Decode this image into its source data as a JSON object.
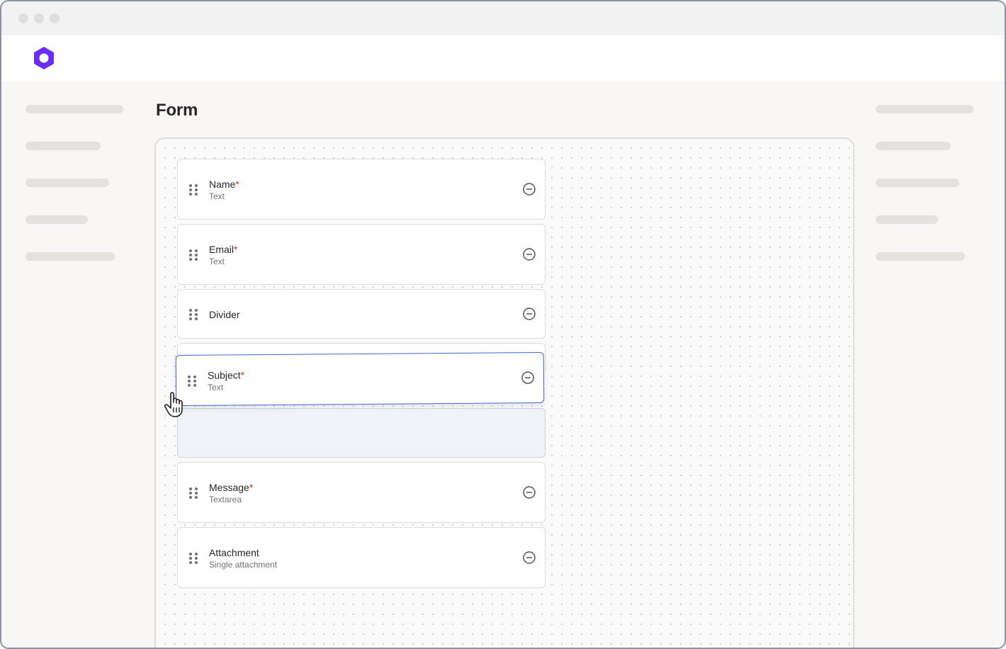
{
  "window": {
    "traffic_lights": [
      "close",
      "minimize",
      "maximize"
    ]
  },
  "header": {
    "logo_icon": "hexagon-logo-icon",
    "brand_color": "#6b2cf5"
  },
  "main": {
    "page_title": "Form",
    "fields": [
      {
        "label": "Name",
        "required": "*",
        "type": "Text"
      },
      {
        "label": "Email",
        "required": "*",
        "type": "Text"
      },
      {
        "label": "Divider",
        "required": "",
        "type": ""
      },
      {
        "label": "Subject",
        "required": "*",
        "type": "Text",
        "state": "dragging"
      },
      {
        "label": "Message",
        "required": "*",
        "type": "Textarea"
      },
      {
        "label": "Attachment",
        "required": "",
        "type": "Single attachment"
      }
    ],
    "icons": {
      "drag": "drag-handle-icon",
      "remove": "remove-circle-icon",
      "cursor": "grab-hand-cursor-icon"
    },
    "colors": {
      "required": "#d92d20",
      "drag_border": "#4b63d6",
      "drop_zone": "#f0f3f8"
    }
  }
}
